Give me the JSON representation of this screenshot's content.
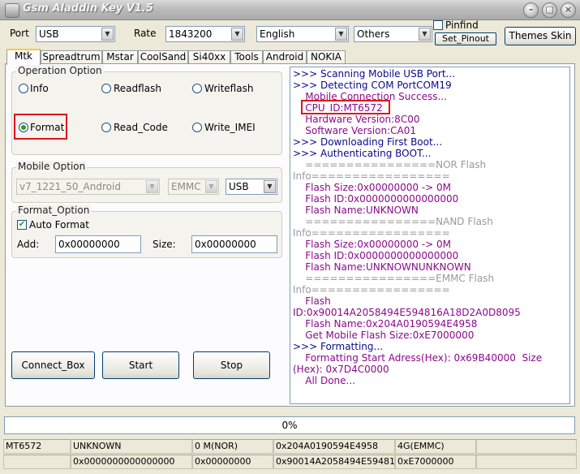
{
  "window": {
    "title": "Gsm Aladdin Key V1.5"
  },
  "top": {
    "port_label": "Port",
    "port_value": "USB",
    "rate_label": "Rate",
    "rate_value": "1843200",
    "language_value": "English",
    "others_value": "Others",
    "pinfind_label": "Pinfind",
    "pinfind_checked": false,
    "set_pinout_label": "Set_Pinout",
    "themes_skin_label": "Themes Skin"
  },
  "tabs": [
    "Mtk",
    "Spreadtrum",
    "Mstar",
    "CoolSand",
    "Si40xx",
    "Tools",
    "Android",
    "NOKIA"
  ],
  "active_tab": "Mtk",
  "operation": {
    "title": "Operation Option",
    "options": [
      "Info",
      "Readflash",
      "Writeflash",
      "Format",
      "Read_Code",
      "Write_IMEI"
    ],
    "selected": "Format"
  },
  "mobile_option": {
    "title": "Mobile Option",
    "model": "v7_1221_50_Android",
    "storage": "EMMC",
    "connection": "USB"
  },
  "format_option": {
    "title": "Format_Option",
    "auto_format_label": "Auto Format",
    "auto_format_checked": true,
    "add_label": "Add:",
    "add_value": "0x00000000",
    "size_label": "Size:",
    "size_value": "0x00000000"
  },
  "buttons": {
    "connect_box": "Connect_Box",
    "start": "Start",
    "stop": "Stop"
  },
  "log": [
    {
      "text": ">>> Scanning Mobile USB Port...",
      "color": "blue"
    },
    {
      "text": ">>> Detecting COM PortCOM19",
      "color": "blue"
    },
    {
      "text": "    Mobile Connection Success...",
      "color": "purple"
    },
    {
      "text": "    CPU_ID:MT6572",
      "color": "purple"
    },
    {
      "text": "    Hardware Version:8C00",
      "color": "purple"
    },
    {
      "text": "    Software Version:CA01",
      "color": "purple"
    },
    {
      "text": ">>> Downloading First Boot...",
      "color": "blue"
    },
    {
      "text": ">>> Authenticating BOOT...",
      "color": "blue"
    },
    {
      "text": "    ================NOR Flash",
      "color": "grey"
    },
    {
      "text": "Info=================",
      "color": "grey"
    },
    {
      "text": "    Flash Size:0x00000000 -> 0M",
      "color": "purple"
    },
    {
      "text": "    Flash ID:0x0000000000000000",
      "color": "purple"
    },
    {
      "text": "    Flash Name:UNKNOWN",
      "color": "purple"
    },
    {
      "text": "    ================NAND Flash",
      "color": "grey"
    },
    {
      "text": "Info=================",
      "color": "grey"
    },
    {
      "text": "    Flash Size:0x00000000 -> 0M",
      "color": "purple"
    },
    {
      "text": "    Flash ID:0x0000000000000000",
      "color": "purple"
    },
    {
      "text": "    Flash Name:UNKNOWNUNKNOWN",
      "color": "purple"
    },
    {
      "text": "    ================EMMC Flash",
      "color": "grey"
    },
    {
      "text": "Info=================",
      "color": "grey"
    },
    {
      "text": "    Flash",
      "color": "purple"
    },
    {
      "text": "ID:0x90014A2058494E594816A18D2A0D8095",
      "color": "purple"
    },
    {
      "text": "    Flash Name:0x204A0190594E4958",
      "color": "purple"
    },
    {
      "text": "    Get Mobile Flash Size:0xE7000000",
      "color": "purple"
    },
    {
      "text": ">>> Formatting...",
      "color": "blue"
    },
    {
      "text": "    Formatting Start Adress(Hex): 0x69B40000  Size",
      "color": "purple"
    },
    {
      "text": "(Hex): 0x7D4C0000",
      "color": "purple"
    },
    {
      "text": "    All Done...",
      "color": "purple"
    }
  ],
  "colors": {
    "blue": "#0a0a8a",
    "purple": "#8b0a8b",
    "grey": "#9a9a9a",
    "highlight": "#e0141b"
  },
  "progress": {
    "percent": 0,
    "label": "0%"
  },
  "status": {
    "row1": [
      "MT6572",
      "UNKNOWN",
      "0 M(NOR)",
      "0x204A0190594E4958",
      "4G(EMMC)",
      ""
    ],
    "row2": [
      "",
      "0x0000000000000000",
      "0x00000000",
      "0x90014A2058494E594816A1",
      "0xE7000000",
      ""
    ]
  }
}
